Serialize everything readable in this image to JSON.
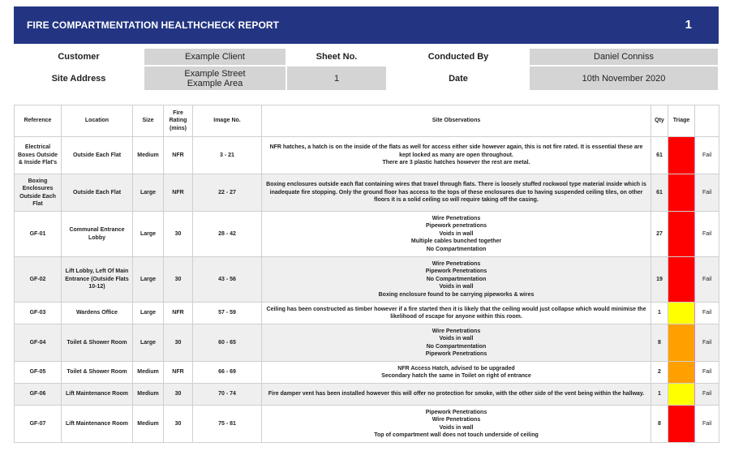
{
  "report": {
    "title": "FIRE COMPARTMENTATION HEALTHCHECK REPORT",
    "number": "1",
    "customer_label": "Customer",
    "customer": "Example Client",
    "sheet_label": "Sheet No.",
    "conducted_label": "Conducted By",
    "conducted_by": "Daniel Conniss",
    "site_label": "Site Address",
    "site_line1": "Example Street",
    "site_line2": "Example Area",
    "sheet_no": "1",
    "date_label": "Date",
    "date": "10th November 2020"
  },
  "colors": {
    "header_bg": "#233582",
    "red": "#ff0000",
    "orange": "#ffa000",
    "yellow": "#ffff00"
  },
  "table": {
    "headers": {
      "reference": "Reference",
      "location": "Location",
      "size": "Size",
      "fire_rating": "Fire Rating (mins)",
      "image_no": "Image No.",
      "observations": "Site Observations",
      "qty": "Qty",
      "triage": "Triage"
    },
    "rows": [
      {
        "reference": "Electrical Boxes Outside & Inside Flat's",
        "location": "Outside Each Flat",
        "size": "Medium",
        "rating": "NFR",
        "images": "3 - 21",
        "observations": [
          "NFR hatches, a hatch is on the inside of the flats as well for access either side however again, this is not fire rated. It is essential these are kept locked as many are open throughout.",
          "There are 3 plastic hatches however the rest are metal."
        ],
        "qty": "61",
        "triage": "red",
        "result": "Fail"
      },
      {
        "reference": "Boxing Enclosures Outside Each Flat",
        "location": "Outside Each Flat",
        "size": "Large",
        "rating": "NFR",
        "images": "22 - 27",
        "observations": [
          "Boxing enclosures outside each flat containing wires that travel through flats. There is loosely stuffed rockwool type material inside which is inadequate fire stopping. Only the ground floor has access to the tops of these enclosures due to having suspended ceiling tiles, on other floors it is a solid ceiling so will require taking off the casing."
        ],
        "qty": "61",
        "triage": "red",
        "result": "Fail"
      },
      {
        "reference": "GF-01",
        "location": "Communal Entrance Lobby",
        "size": "Large",
        "rating": "30",
        "images": "28 - 42",
        "observations": [
          "Wire Penetrations",
          "Pipework penetrations",
          "Voids in wall",
          "Multiple cables bunched together",
          "No Compartmentation"
        ],
        "qty": "27",
        "triage": "red",
        "result": "Fail"
      },
      {
        "reference": "GF-02",
        "location": "Lift Lobby, Left Of Main Entrance (Outside Flats 10-12)",
        "size": "Large",
        "rating": "30",
        "images": "43 - 56",
        "observations": [
          "Wire Penetrations",
          "Pipework Penetrations",
          "No Compartmentation",
          "Voids in wall",
          "Boxing enclosure found to be carrying pipeworks & wires"
        ],
        "qty": "19",
        "triage": "red",
        "result": "Fail"
      },
      {
        "reference": "GF-03",
        "location": "Wardens Office",
        "size": "Large",
        "rating": "NFR",
        "images": "57 - 59",
        "observations": [
          "Ceiling has been constructed as timber however if a fire started then it is likely that the ceiling would just collapse which would minimise the likelihood of escape for anyone within this room."
        ],
        "qty": "1",
        "triage": "yellow",
        "result": "Fail"
      },
      {
        "reference": "GF-04",
        "location": "Toilet & Shower Room",
        "size": "Large",
        "rating": "30",
        "images": "60 - 65",
        "observations": [
          "Wire Penetrations",
          "Voids in wall",
          "No Compartmentation",
          "Pipework Penetrations"
        ],
        "qty": "8",
        "triage": "orange",
        "result": "Fail"
      },
      {
        "reference": "GF-05",
        "location": "Toilet & Shower Room",
        "size": "Medium",
        "rating": "NFR",
        "images": "66 - 69",
        "observations": [
          "NFR Access Hatch, advised to be upgraded",
          "Secondary hatch the same in Toilet on right of entrance"
        ],
        "qty": "2",
        "triage": "orange",
        "result": "Fail"
      },
      {
        "reference": "GF-06",
        "location": "Lift Maintenance Room",
        "size": "Medium",
        "rating": "30",
        "images": "70 - 74",
        "observations": [
          "Fire damper vent has been installed however this will offer no protection for smoke, with the other side of the vent being within the hallway."
        ],
        "qty": "1",
        "triage": "yellow",
        "result": "Fail"
      },
      {
        "reference": "GF-07",
        "location": "Lift Maintenance Room",
        "size": "Medium",
        "rating": "30",
        "images": "75 - 81",
        "observations": [
          "Pipework Penetrations",
          "Wire Penetrations",
          "Voids in wall",
          "Top of compartment wall does not touch underside of ceiling"
        ],
        "qty": "8",
        "triage": "red",
        "result": "Fail"
      }
    ]
  }
}
